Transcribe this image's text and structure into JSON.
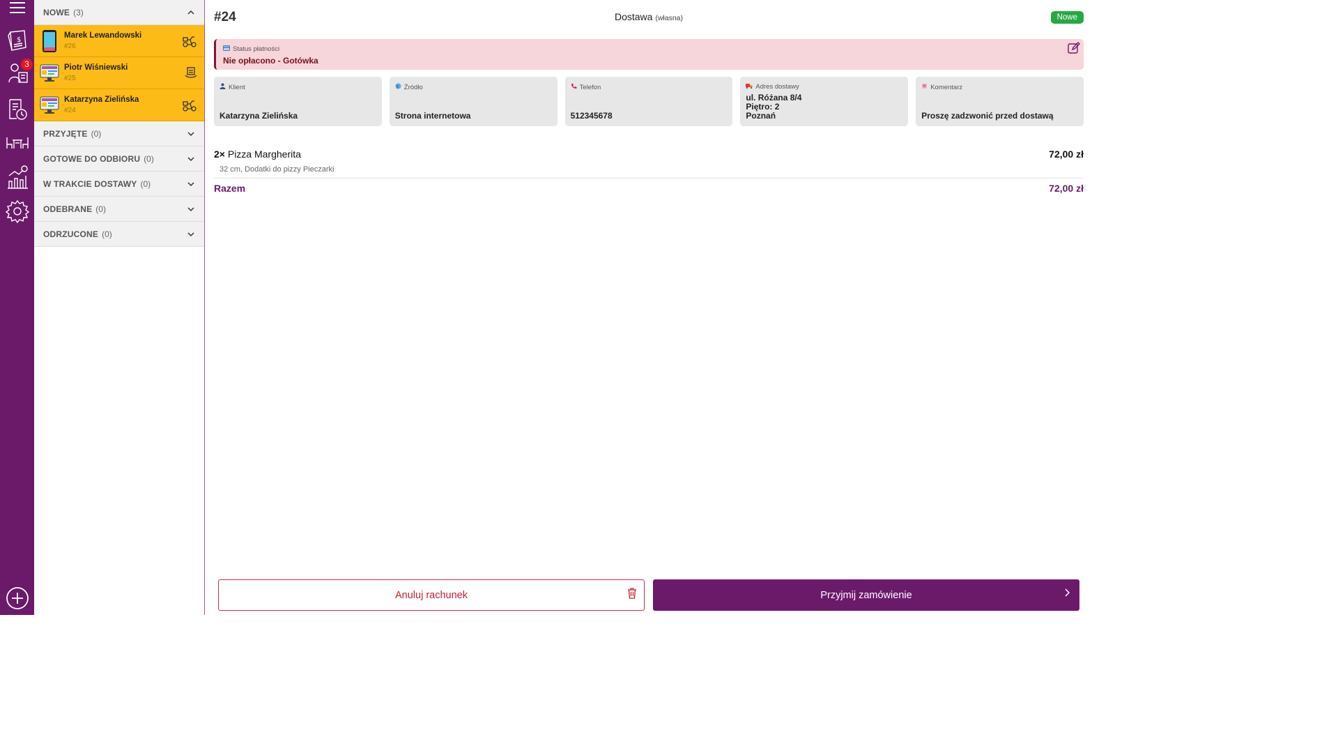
{
  "rail": {
    "badge_count": "3",
    "icons": [
      "menu-icon",
      "cash-register-icon",
      "delivery-orders-icon",
      "order-history-icon",
      "tables-icon",
      "reports-icon",
      "settings-icon",
      "add-icon"
    ]
  },
  "groups": {
    "nowe": {
      "name": "NOWE",
      "count": "(3)"
    },
    "przyjete": {
      "name": "PRZYJĘTE",
      "count": "(0)"
    },
    "gotowe": {
      "name": "GOTOWE DO ODBIORU",
      "count": "(0)"
    },
    "w_trakcie": {
      "name": "W TRAKCIE DOSTAWY",
      "count": "(0)"
    },
    "odebrane": {
      "name": "ODEBRANE",
      "count": "(0)"
    },
    "odrzucone": {
      "name": "ODRZUCONE",
      "count": "(0)"
    }
  },
  "orders": [
    {
      "customer": "Marek Lewandowski",
      "number": "#26",
      "source_icon": "phone-icon",
      "type_icon": "delivery-scooter-icon"
    },
    {
      "customer": "Piotr Wiśniewski",
      "number": "#25",
      "source_icon": "website-icon",
      "type_icon": "takeaway-icon"
    },
    {
      "customer": "Katarzyna Zielińska",
      "number": "#24",
      "source_icon": "website-icon",
      "type_icon": "delivery-scooter-icon"
    }
  ],
  "detail": {
    "order_number": "#24",
    "delivery_label": "Dostawa",
    "delivery_sub": "(własna)",
    "status": "Nowe",
    "payment_label": "Status płatności",
    "payment_value": "Nie opłacono - Gotówka",
    "cards": {
      "klient": {
        "label": "Klient",
        "value": "Katarzyna Zielińska"
      },
      "zrodlo": {
        "label": "Źródło",
        "value": "Strona internetowa"
      },
      "telefon": {
        "label": "Telefon",
        "value": "512345678"
      },
      "adres": {
        "label": "Adres dostawy",
        "line1": "ul. Różana 8/4",
        "line2": "Piętro: 2",
        "line3": "Poznań"
      },
      "komentarz": {
        "label": "Komentarz",
        "value": "Proszę zadzwonić przed dostawą"
      }
    },
    "item": {
      "qty": "2×",
      "name": "Pizza Margherita",
      "price": "72,00 zł",
      "desc": "32 cm, Dodatki do pizzy Pieczarki"
    },
    "total_label": "Razem",
    "total_value": "72,00 zł",
    "cancel_label": "Anuluj rachunek",
    "accept_label": "Przyjmij zamówienie"
  },
  "colors": {
    "brand": "#6b1a6a",
    "highlight": "#fdbb17",
    "success": "#28a745",
    "danger": "#c8202a",
    "payment_bg": "#f6d6da"
  }
}
